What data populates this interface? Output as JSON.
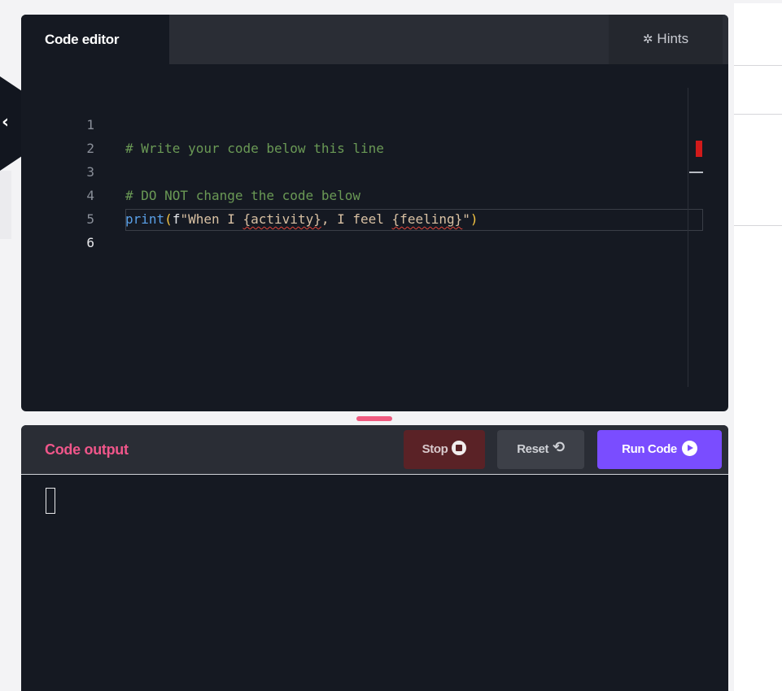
{
  "editor": {
    "tab_label": "Code editor",
    "hints_label": "Hints",
    "hints_icon": "lightbulb-icon",
    "lines": [
      {
        "number": "1",
        "text": "# Write your code below this line"
      },
      {
        "number": "2",
        "text": ""
      },
      {
        "number": "3",
        "text": "# DO NOT change the code below"
      },
      {
        "number": "4",
        "text": "print(f\"When I {activity}, I feel {feeling}\")"
      },
      {
        "number": "5",
        "text": ""
      },
      {
        "number": "6",
        "text": ""
      }
    ],
    "code_tokens": {
      "print": "print",
      "open_paren": "(",
      "prefix": "f",
      "str_a": "\"When I ",
      "activity": "{activity}",
      "str_b": ", I feel ",
      "feeling": "{feeling}",
      "str_c": "\"",
      "close_paren": ")"
    },
    "active_line": 6
  },
  "output": {
    "title": "Code output",
    "stop_label": "Stop",
    "reset_label": "Reset",
    "run_label": "Run Code"
  },
  "colors": {
    "accent_purple": "#7a4dff",
    "accent_pink": "#f0568a",
    "editor_bg": "#151922",
    "comment": "#6a9955",
    "error_marker": "#d11a1a"
  }
}
